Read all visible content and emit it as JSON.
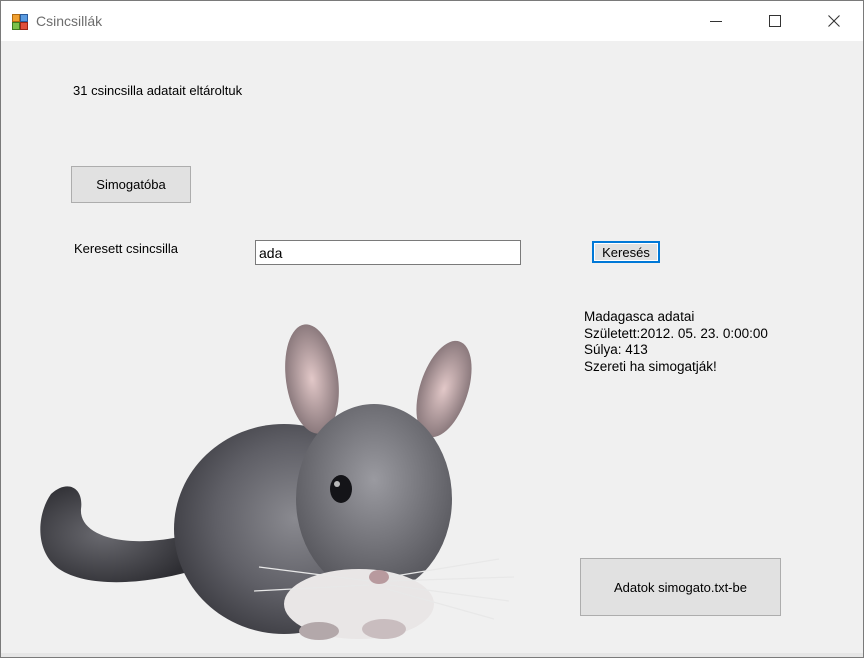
{
  "window": {
    "title": "Csincsillák"
  },
  "icons": {
    "app": "windows-forms-app-icon",
    "minimize": "minimize-icon",
    "maximize": "maximize-icon",
    "close": "close-icon"
  },
  "main": {
    "status_text": "31 csincsilla adatait eltároltuk",
    "petting_button_label": "Simogatóba",
    "search_label": "Keresett csincsilla",
    "search_value": "ada",
    "search_button_label": "Keresés",
    "info": {
      "line1": "Madagasca adatai",
      "line2": "Született:2012. 05. 23. 0:00:00",
      "line3": "Súlya: 413",
      "line4": "Szereti ha simogatják!"
    },
    "export_button_label": "Adatok simogato.txt-be"
  },
  "colors": {
    "window_bg": "#f0f0f0",
    "titlebar_bg": "#ffffff",
    "button_bg": "#e1e1e1",
    "focus_border": "#0078d7"
  }
}
